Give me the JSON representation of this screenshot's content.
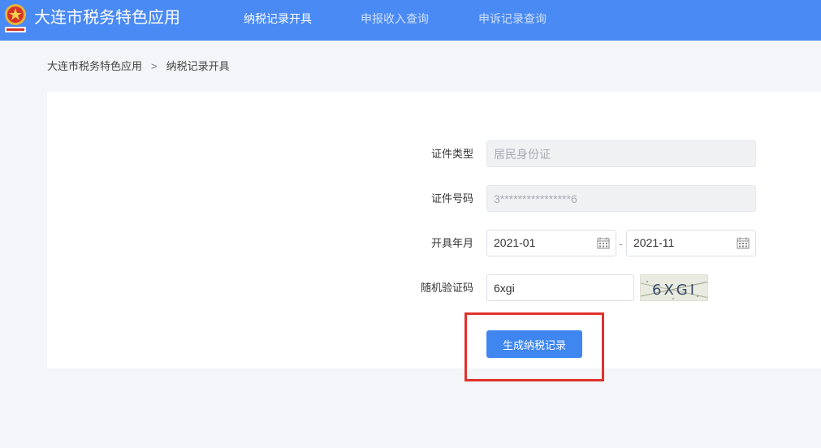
{
  "header": {
    "title": "大连市税务特色应用",
    "logo_icon": "tax-emblem-icon",
    "nav": [
      {
        "label": "纳税记录开具",
        "active": true
      },
      {
        "label": "申报收入查询",
        "active": false
      },
      {
        "label": "申诉记录查询",
        "active": false
      }
    ]
  },
  "breadcrumb": {
    "root": "大连市税务特色应用",
    "separator": ">",
    "current": "纳税记录开具"
  },
  "form": {
    "id_type": {
      "label": "证件类型",
      "value": "居民身份证"
    },
    "id_number": {
      "label": "证件号码",
      "value": "3****************6"
    },
    "period": {
      "label": "开具年月",
      "start": "2021-01",
      "end": "2021-11",
      "separator": "-",
      "icon": "calendar-icon"
    },
    "captcha": {
      "label": "随机验证码",
      "value": "6xgi",
      "image_text": "6XGI"
    },
    "submit_label": "生成纳税记录"
  },
  "colors": {
    "header_bg": "#4a8af4",
    "primary_button": "#3f86f0",
    "highlight_border": "#e0322b",
    "page_bg": "#f3f5f8"
  }
}
